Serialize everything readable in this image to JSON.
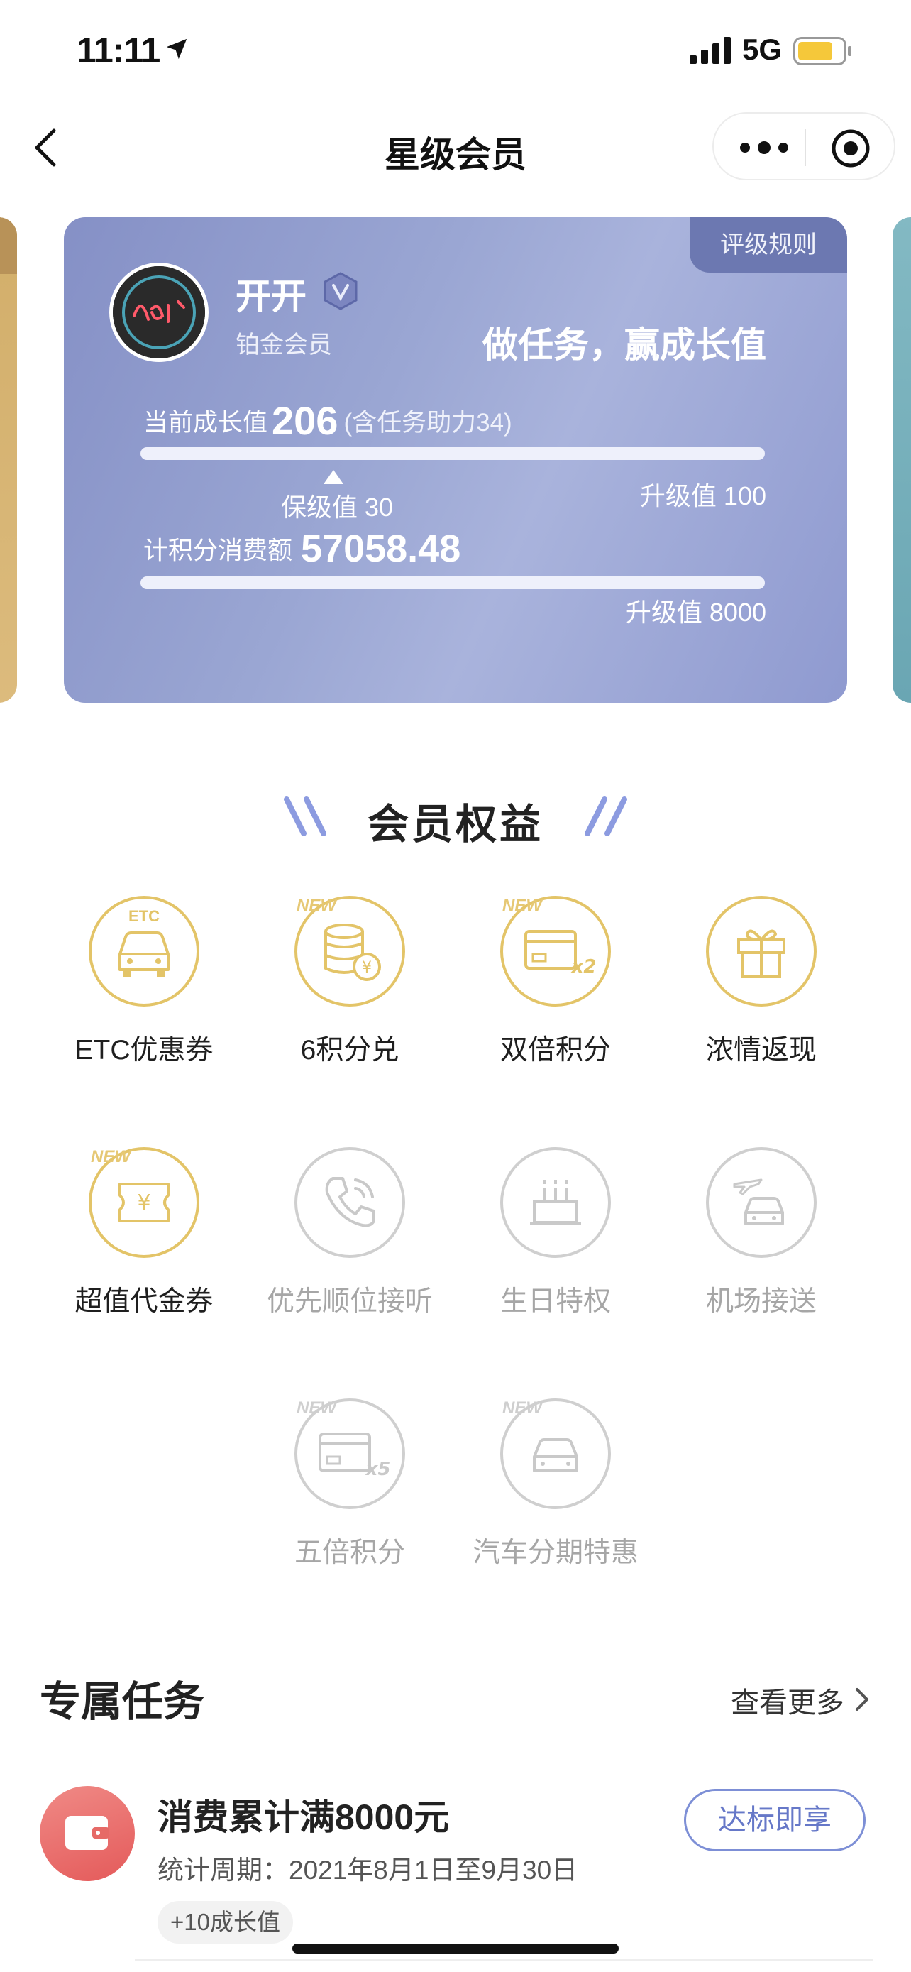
{
  "status_bar": {
    "time": "11:11",
    "network": "5G",
    "battery_color": "#f5c83a"
  },
  "nav": {
    "title": "星级会员",
    "back_icon": "chevron-left-icon",
    "more_icon": "more-dots-icon",
    "close_icon": "target-icon"
  },
  "member_card": {
    "rule_link": "评级规则",
    "user_name": "开开",
    "level_name": "铂金会员",
    "slogan": "做任务，赢成长值",
    "growth_label": "当前成长值",
    "growth_value": "206",
    "growth_note": "(含任务助力34)",
    "growth_progress": 0.0,
    "keep_value": "保级值  30",
    "upgrade_growth": "升级值 100",
    "spend_label": "计积分消费额",
    "spend_value": "57058.48",
    "upgrade_spend": "升级值 8000",
    "colors": {
      "card": "#949fd0",
      "tab": "#6c78b1"
    }
  },
  "benefits": {
    "title": "会员权益",
    "items": [
      {
        "label": "ETC优惠券",
        "icon": "car-icon",
        "tag": "ETC",
        "active": true
      },
      {
        "label": "6积分兑",
        "icon": "coin-stack-icon",
        "tag": "NEW",
        "active": true
      },
      {
        "label": "双倍积分",
        "icon": "card-x2-icon",
        "tag": "NEW",
        "active": true
      },
      {
        "label": "浓情返现",
        "icon": "gift-icon",
        "tag": "",
        "active": true
      },
      {
        "label": "超值代金券",
        "icon": "voucher-icon",
        "tag": "NEW",
        "active": true
      },
      {
        "label": "优先顺位接听",
        "icon": "phone-icon",
        "tag": "",
        "active": false
      },
      {
        "label": "生日特权",
        "icon": "birthday-cake-icon",
        "tag": "",
        "active": false
      },
      {
        "label": "机场接送",
        "icon": "airport-car-icon",
        "tag": "",
        "active": false
      },
      {
        "label": "五倍积分",
        "icon": "card-x5-icon",
        "tag": "NEW",
        "active": false
      },
      {
        "label": "汽车分期特惠",
        "icon": "car-installment-icon",
        "tag": "NEW",
        "active": false
      }
    ],
    "active_color": "#e3c468",
    "inactive_color": "#cfcfcf"
  },
  "tasks": {
    "title": "专属任务",
    "see_more": "查看更多",
    "items": [
      {
        "name": "消费累计满8000元",
        "period": "统计周期：2021年8月1日至9月30日",
        "reward": "+10成长值",
        "button": "达标即享",
        "icon": "wallet-icon"
      }
    ]
  }
}
